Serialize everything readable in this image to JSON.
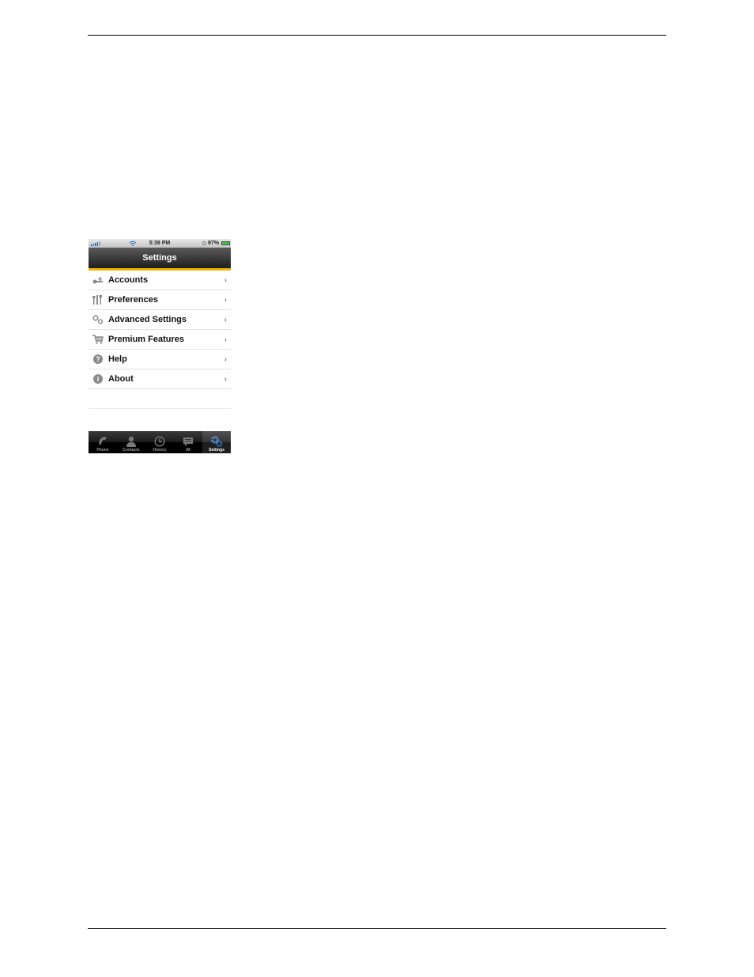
{
  "page": {
    "header_rule": true,
    "footer_rule": true
  },
  "phone": {
    "status_bar": {
      "time": "5:39 PM",
      "battery": "97%",
      "battery_color": "#3ec43e",
      "signal_color": "#2a6ec8"
    },
    "nav_bar": {
      "title": "Settings",
      "accent_color": "#f0b400"
    },
    "menu": [
      {
        "label": "Accounts",
        "icon": "accounts-icon"
      },
      {
        "label": "Preferences",
        "icon": "preferences-icon"
      },
      {
        "label": "Advanced Settings",
        "icon": "gears-icon"
      },
      {
        "label": "Premium Features",
        "icon": "cart-icon"
      },
      {
        "label": "Help",
        "icon": "help-icon"
      },
      {
        "label": "About",
        "icon": "info-icon"
      }
    ],
    "chevron": "›",
    "help_glyph": "?",
    "info_glyph": "i",
    "tabs": [
      {
        "label": "Phone",
        "icon": "phone-icon",
        "active": false
      },
      {
        "label": "Contacts",
        "icon": "contacts-icon",
        "active": false
      },
      {
        "label": "History",
        "icon": "history-icon",
        "active": false
      },
      {
        "label": "IM",
        "icon": "im-icon",
        "active": false
      },
      {
        "label": "Settings",
        "icon": "settings-icon",
        "active": true
      }
    ]
  }
}
